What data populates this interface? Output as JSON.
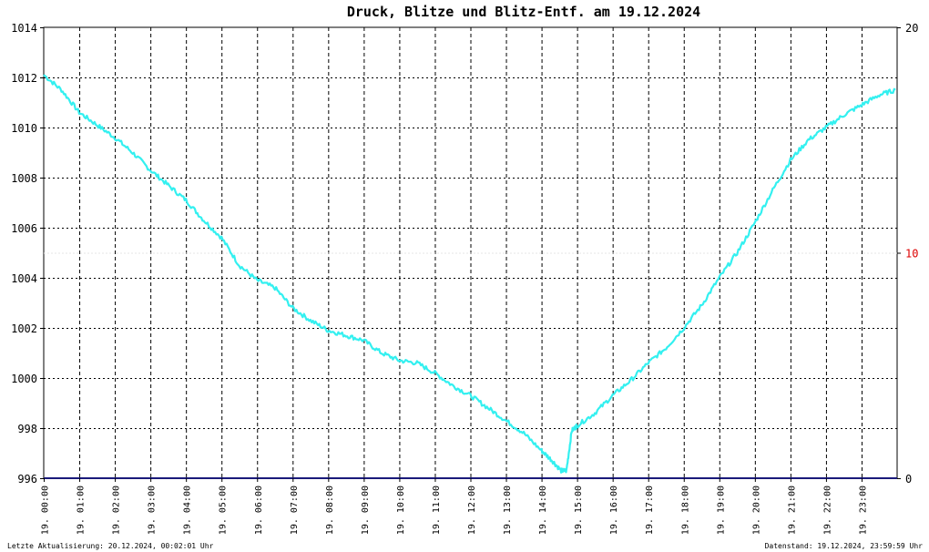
{
  "title": {
    "parts": [
      {
        "text": "Druck",
        "color": "#33e6e6"
      },
      {
        "text": ",",
        "color": "#6666cc"
      },
      {
        "text": " Blitze",
        "color": "#6666cc"
      },
      {
        "text": " und ",
        "color": "#000000"
      },
      {
        "text": "Blitz-Entf.",
        "color": "#dd0000"
      },
      {
        "text": " am 19.12.2024",
        "color": "#000000"
      }
    ]
  },
  "footer": {
    "left": "Letzte Aktualisierung: 20.12.2024, 00:02:01 Uhr",
    "right": "Datenstand: 19.12.2024, 23:59:59 Uhr"
  },
  "colors": {
    "pressure": "#33f0f0",
    "lightning": "#1a1a7a",
    "distance_label": "#dd0000",
    "grid": "#000000"
  },
  "chart_data": {
    "type": "line",
    "x_labels": [
      "19. 00:00",
      "19. 01:00",
      "19. 02:00",
      "19. 03:00",
      "19. 04:00",
      "19. 05:00",
      "19. 06:00",
      "19. 07:00",
      "19. 08:00",
      "19. 09:00",
      "19. 10:00",
      "19. 11:00",
      "19. 12:00",
      "19. 13:00",
      "19. 14:00",
      "19. 15:00",
      "19. 16:00",
      "19. 17:00",
      "19. 18:00",
      "19. 19:00",
      "19. 20:00",
      "19. 21:00",
      "19. 22:00",
      "19. 23:00"
    ],
    "x_range_hours": [
      0,
      24
    ],
    "y_left": {
      "ticks": [
        "996",
        "998",
        "1000",
        "1002",
        "1004",
        "1006",
        "1008",
        "1010",
        "1012",
        "1014"
      ],
      "range": [
        996,
        1014
      ]
    },
    "y_right": {
      "ticks": [
        "0",
        "10",
        "20"
      ],
      "red_tick": "10",
      "range": [
        0,
        20
      ]
    },
    "grid": true,
    "series": [
      {
        "name": "Druck",
        "points": [
          [
            0,
            1012.1
          ],
          [
            0.5,
            1011.5
          ],
          [
            1,
            1010.6
          ],
          [
            1.5,
            1010.1
          ],
          [
            2,
            1009.6
          ],
          [
            2.5,
            1009.0
          ],
          [
            3,
            1008.3
          ],
          [
            3.5,
            1007.7
          ],
          [
            4,
            1007.1
          ],
          [
            4.5,
            1006.3
          ],
          [
            5,
            1005.6
          ],
          [
            5.5,
            1004.5
          ],
          [
            6,
            1003.9
          ],
          [
            6.5,
            1003.6
          ],
          [
            7,
            1002.8
          ],
          [
            7.5,
            1002.3
          ],
          [
            8,
            1001.9
          ],
          [
            8.5,
            1001.7
          ],
          [
            9,
            1001.5
          ],
          [
            9.5,
            1001.0
          ],
          [
            10,
            1000.7
          ],
          [
            10.5,
            1000.6
          ],
          [
            11,
            1000.2
          ],
          [
            11.5,
            999.7
          ],
          [
            12,
            999.3
          ],
          [
            12.5,
            998.8
          ],
          [
            13,
            998.3
          ],
          [
            13.5,
            997.8
          ],
          [
            14,
            997.1
          ],
          [
            14.3,
            996.7
          ],
          [
            14.55,
            996.3
          ],
          [
            14.7,
            996.3
          ],
          [
            14.85,
            997.9
          ],
          [
            15,
            998.1
          ],
          [
            15.5,
            998.6
          ],
          [
            16,
            999.3
          ],
          [
            16.5,
            999.9
          ],
          [
            17,
            1000.6
          ],
          [
            17.5,
            1001.2
          ],
          [
            18,
            1002.0
          ],
          [
            18.5,
            1002.9
          ],
          [
            19,
            1004.0
          ],
          [
            19.5,
            1005.0
          ],
          [
            20,
            1006.2
          ],
          [
            20.5,
            1007.5
          ],
          [
            21,
            1008.7
          ],
          [
            21.5,
            1009.5
          ],
          [
            22,
            1010.0
          ],
          [
            22.5,
            1010.5
          ],
          [
            23,
            1010.9
          ],
          [
            23.5,
            1011.3
          ],
          [
            23.95,
            1011.5
          ]
        ]
      },
      {
        "name": "Blitze",
        "points": [
          [
            0,
            0
          ],
          [
            24,
            0
          ]
        ]
      }
    ]
  }
}
